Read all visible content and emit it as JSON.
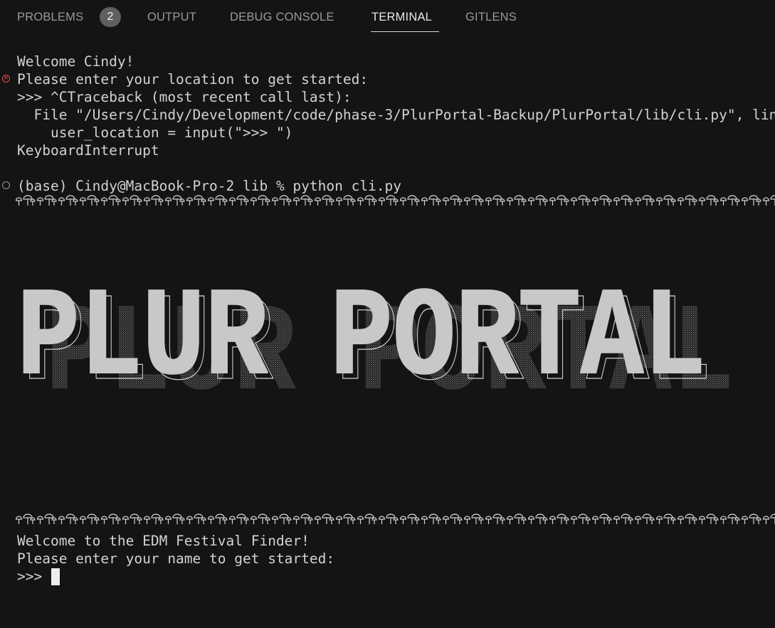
{
  "panel": {
    "tabs": [
      {
        "label": "PROBLEMS",
        "active": false
      },
      {
        "label": "OUTPUT",
        "active": false
      },
      {
        "label": "DEBUG CONSOLE",
        "active": false
      },
      {
        "label": "TERMINAL",
        "active": true
      },
      {
        "label": "GITLENS",
        "active": false
      }
    ],
    "problems_count": "2"
  },
  "terminal": {
    "lines": [
      "Welcome Cindy!",
      "Please enter your location to get started:",
      ">>> ^CTraceback (most recent call last):",
      "  File \"/Users/Cindy/Development/code/phase-3/PlurPortal-Backup/PlurPortal/lib/cli.py\", line",
      "    user_location = input(\">>> \")",
      "KeyboardInterrupt",
      "(base) Cindy@MacBook-Pro-2 lib % python cli.py",
      "Welcome to the EDM Festival Finder!",
      "Please enter your name to get started:",
      ">>> "
    ],
    "banner_text": "PLUR PORTAL",
    "markers": {
      "error": "error-icon",
      "idle": "circle-icon"
    }
  },
  "colors": {
    "background": "#141414",
    "text": "#d2d2d2",
    "banner": "#c8c8c8",
    "error": "#e0524f"
  }
}
